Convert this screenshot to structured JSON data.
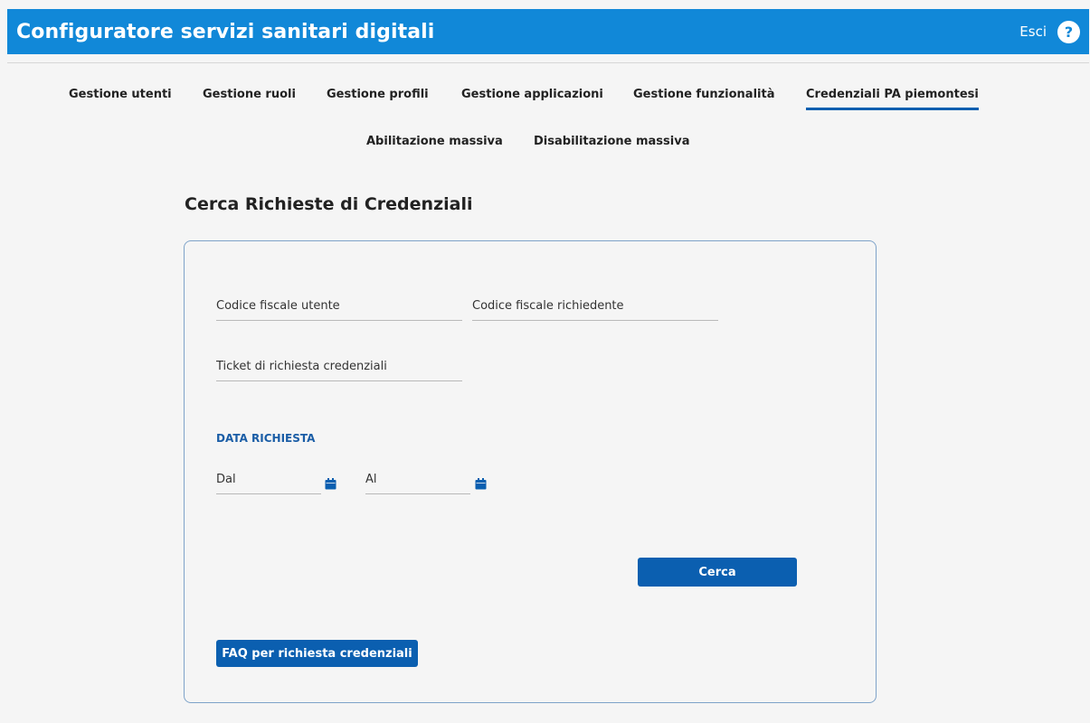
{
  "header": {
    "title": "Configuratore servizi sanitari digitali",
    "logout_label": "Esci",
    "help_symbol": "?"
  },
  "nav": {
    "primary": [
      {
        "label": "Gestione utenti"
      },
      {
        "label": "Gestione ruoli"
      },
      {
        "label": "Gestione profili"
      },
      {
        "label": "Gestione applicazioni"
      },
      {
        "label": "Gestione funzionalità"
      },
      {
        "label": "Credenziali PA piemontesi",
        "active": true
      }
    ],
    "secondary": [
      {
        "label": "Abilitazione massiva"
      },
      {
        "label": "Disabilitazione massiva"
      }
    ]
  },
  "main": {
    "title": "Cerca Richieste di Credenziali",
    "form": {
      "cf_utente_placeholder": "Codice fiscale utente",
      "cf_richiedente_placeholder": "Codice fiscale richiedente",
      "ticket_placeholder": "Ticket di richiesta credenziali",
      "date_section_label": "DATA RICHIESTA",
      "date_from_placeholder": "Dal",
      "date_to_placeholder": "Al",
      "search_label": "Cerca",
      "faq_label": "FAQ per richiesta credenziali"
    }
  },
  "colors": {
    "header_bg": "#1188d8",
    "accent": "#0b5fb0",
    "section_label": "#1a5da6"
  },
  "icons": {
    "help": "help-icon",
    "calendar": "calendar-icon"
  }
}
